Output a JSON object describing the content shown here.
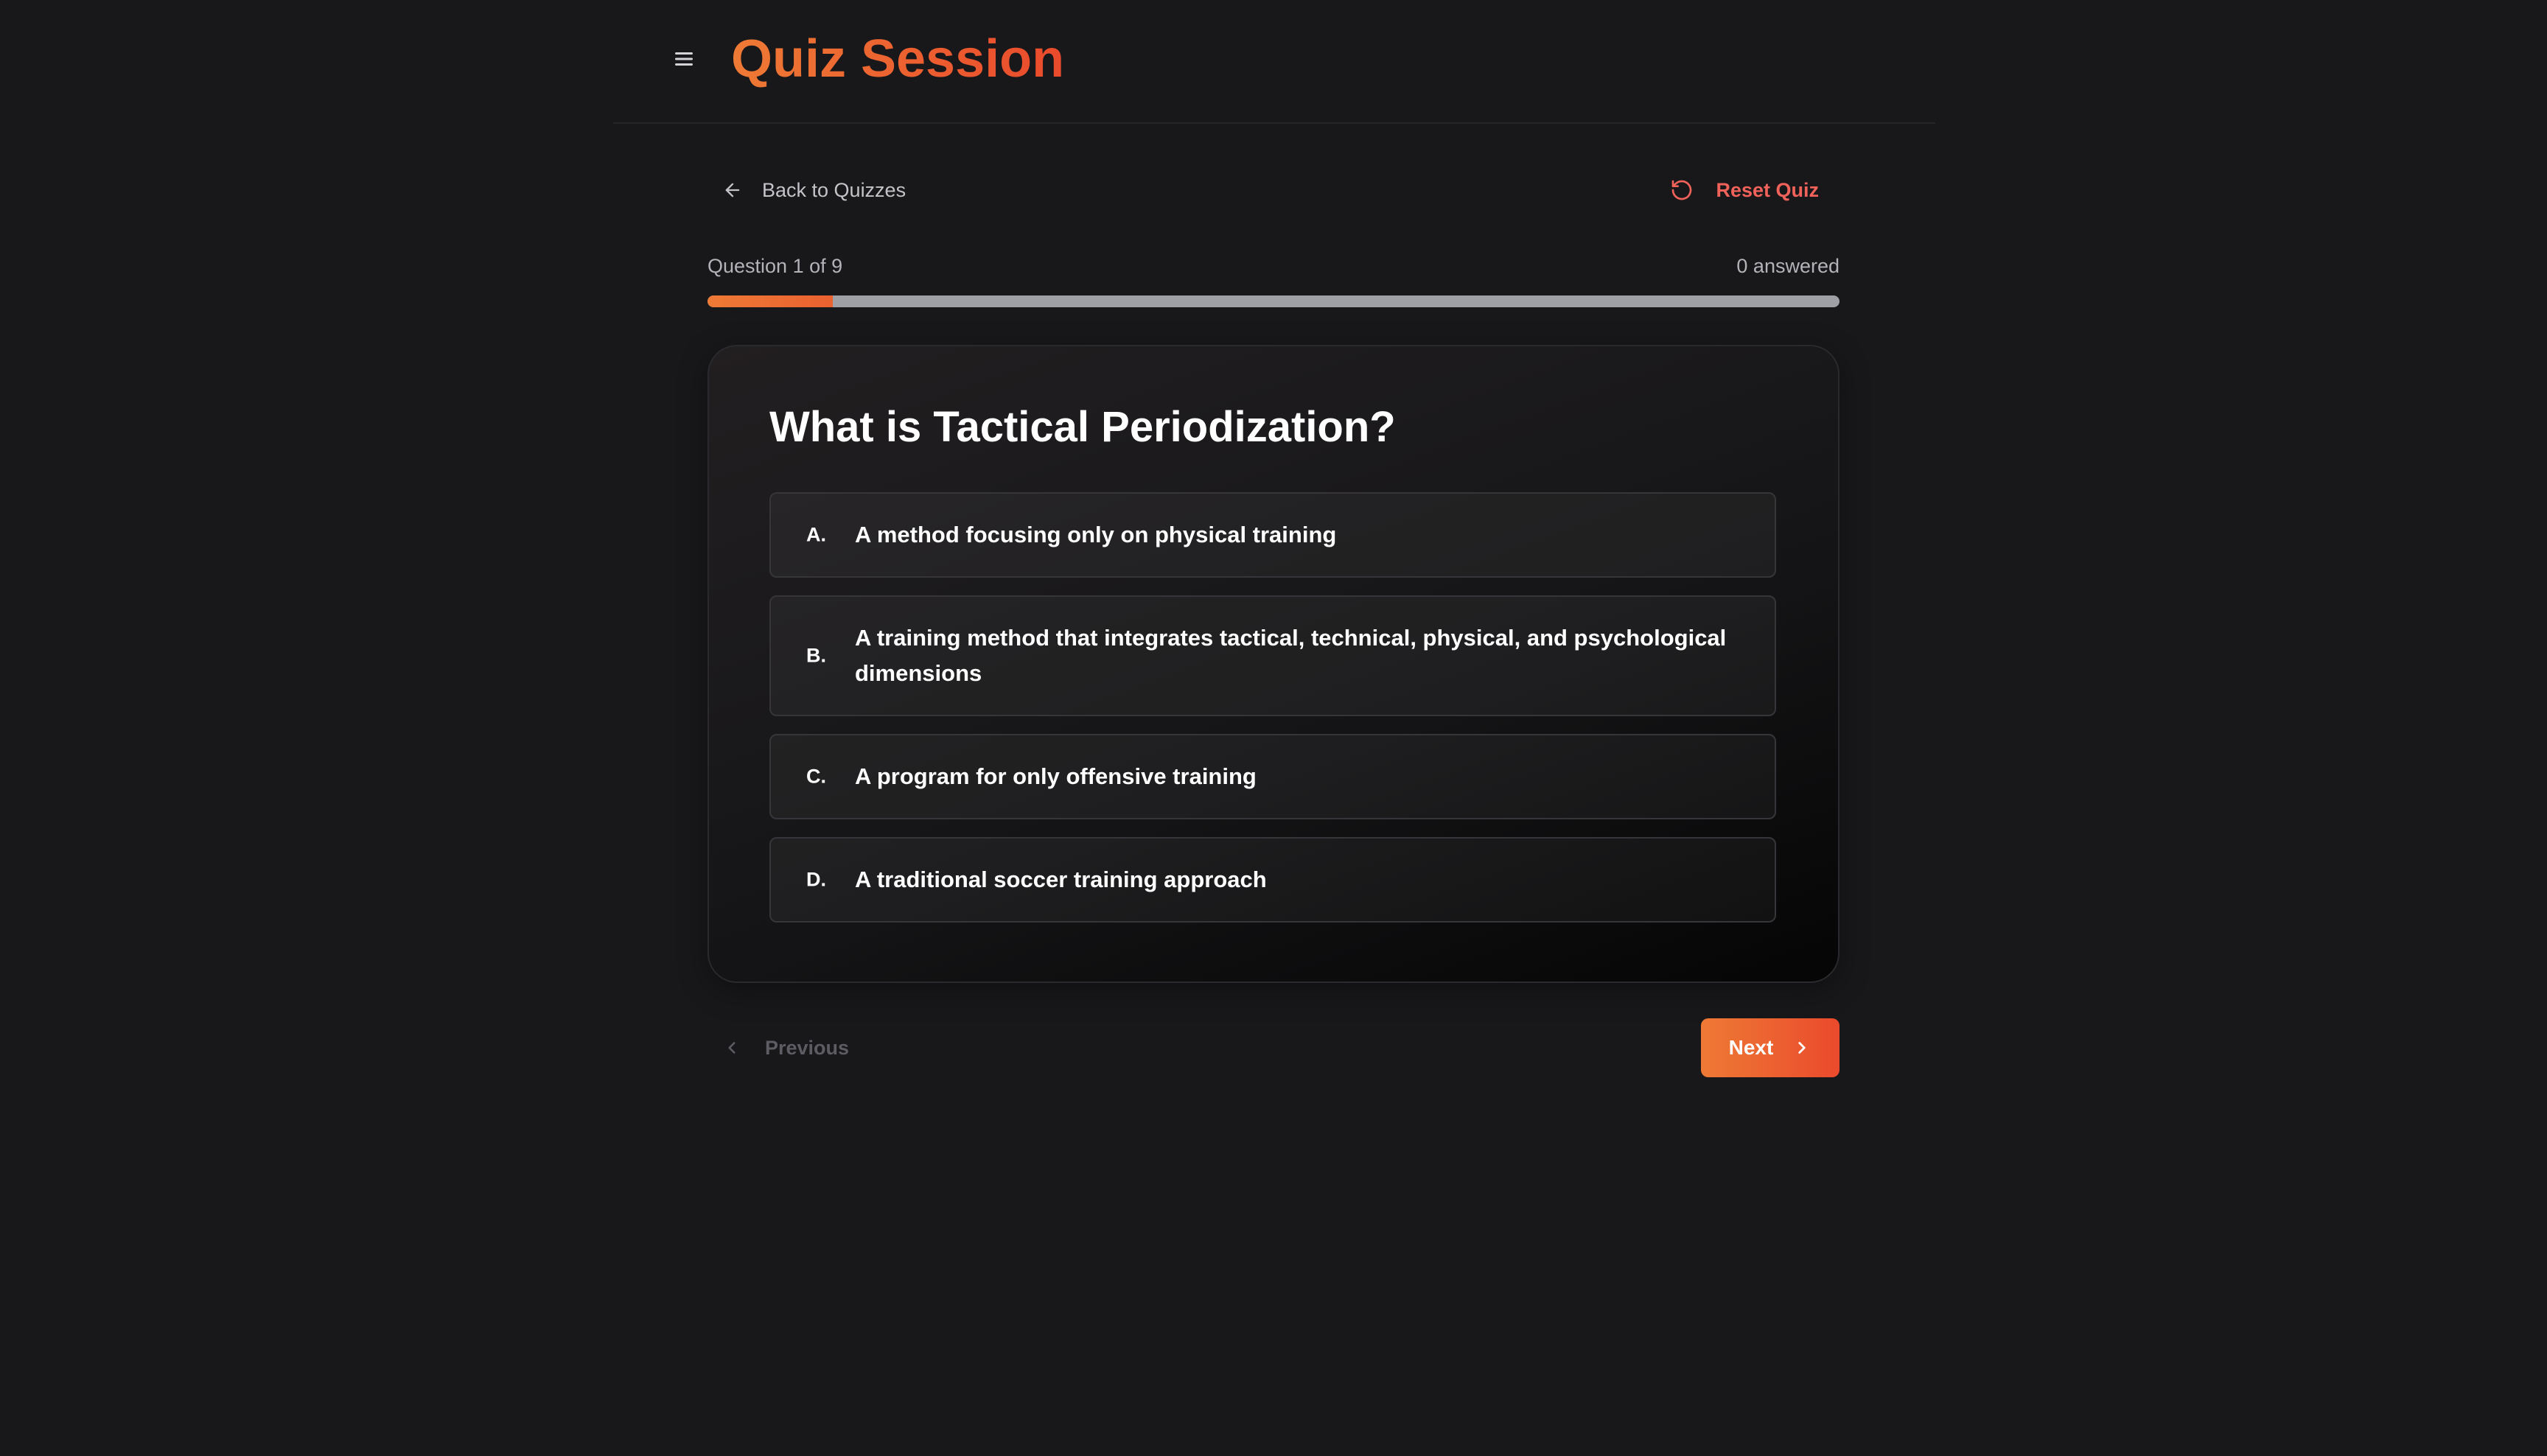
{
  "header": {
    "title": "Quiz Session",
    "menu_icon": "hamburger-menu-icon"
  },
  "nav": {
    "back_label": "Back to Quizzes",
    "back_icon": "arrow-left-icon",
    "reset_label": "Reset Quiz",
    "reset_icon": "rotate-ccw-icon"
  },
  "progress": {
    "question_label": "Question 1 of 9",
    "answered_label": "0 answered",
    "current": 1,
    "total": 9,
    "fill_fraction": 0.111,
    "fill_color": "#ee7a35"
  },
  "question": {
    "title": "What is Tactical Periodization?",
    "options": [
      {
        "letter": "A.",
        "text": "A method focusing only on physical training"
      },
      {
        "letter": "B.",
        "text": "A training method that integrates tactical, technical, physical, and psychological dimensions"
      },
      {
        "letter": "C.",
        "text": "A program for only offensive training"
      },
      {
        "letter": "D.",
        "text": "A traditional soccer training approach"
      }
    ]
  },
  "footer": {
    "previous_label": "Previous",
    "previous_icon": "chevron-left-icon",
    "next_label": "Next",
    "next_icon": "chevron-right-icon"
  },
  "colors": {
    "accent_start": "#ee7a35",
    "accent_end": "#ea4a2c",
    "reset_red": "#f0625a",
    "background": "#18181b"
  }
}
